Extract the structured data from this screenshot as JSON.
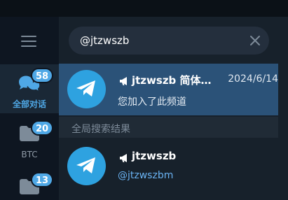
{
  "rail": {
    "folders": [
      {
        "label": "全部对话",
        "badge": "58",
        "icon": "chat-bubbles-icon",
        "active": true
      },
      {
        "label": "BTC",
        "badge": "20",
        "icon": "folder-icon",
        "active": false
      },
      {
        "label": "",
        "badge": "13",
        "icon": "folder-icon",
        "active": false
      }
    ]
  },
  "search": {
    "value": "@jtzwszb"
  },
  "results": {
    "top": {
      "name": "jtzwszb 简体…",
      "date": "2024/6/14",
      "subtitle": "您加入了此频道",
      "type_icon": "channel-megaphone-icon",
      "avatar_icon": "telegram-plane-icon"
    },
    "section_title": "全局搜索结果",
    "global": [
      {
        "name": "jtzwszb",
        "handle": "@jtzwszbm",
        "type_icon": "channel-megaphone-icon",
        "avatar_icon": "telegram-plane-icon"
      }
    ]
  },
  "colors": {
    "accent": "#4fa8e6",
    "selected_row": "#2b5278",
    "avatar": "#2ea2e0",
    "link": "#6ab3f3"
  }
}
